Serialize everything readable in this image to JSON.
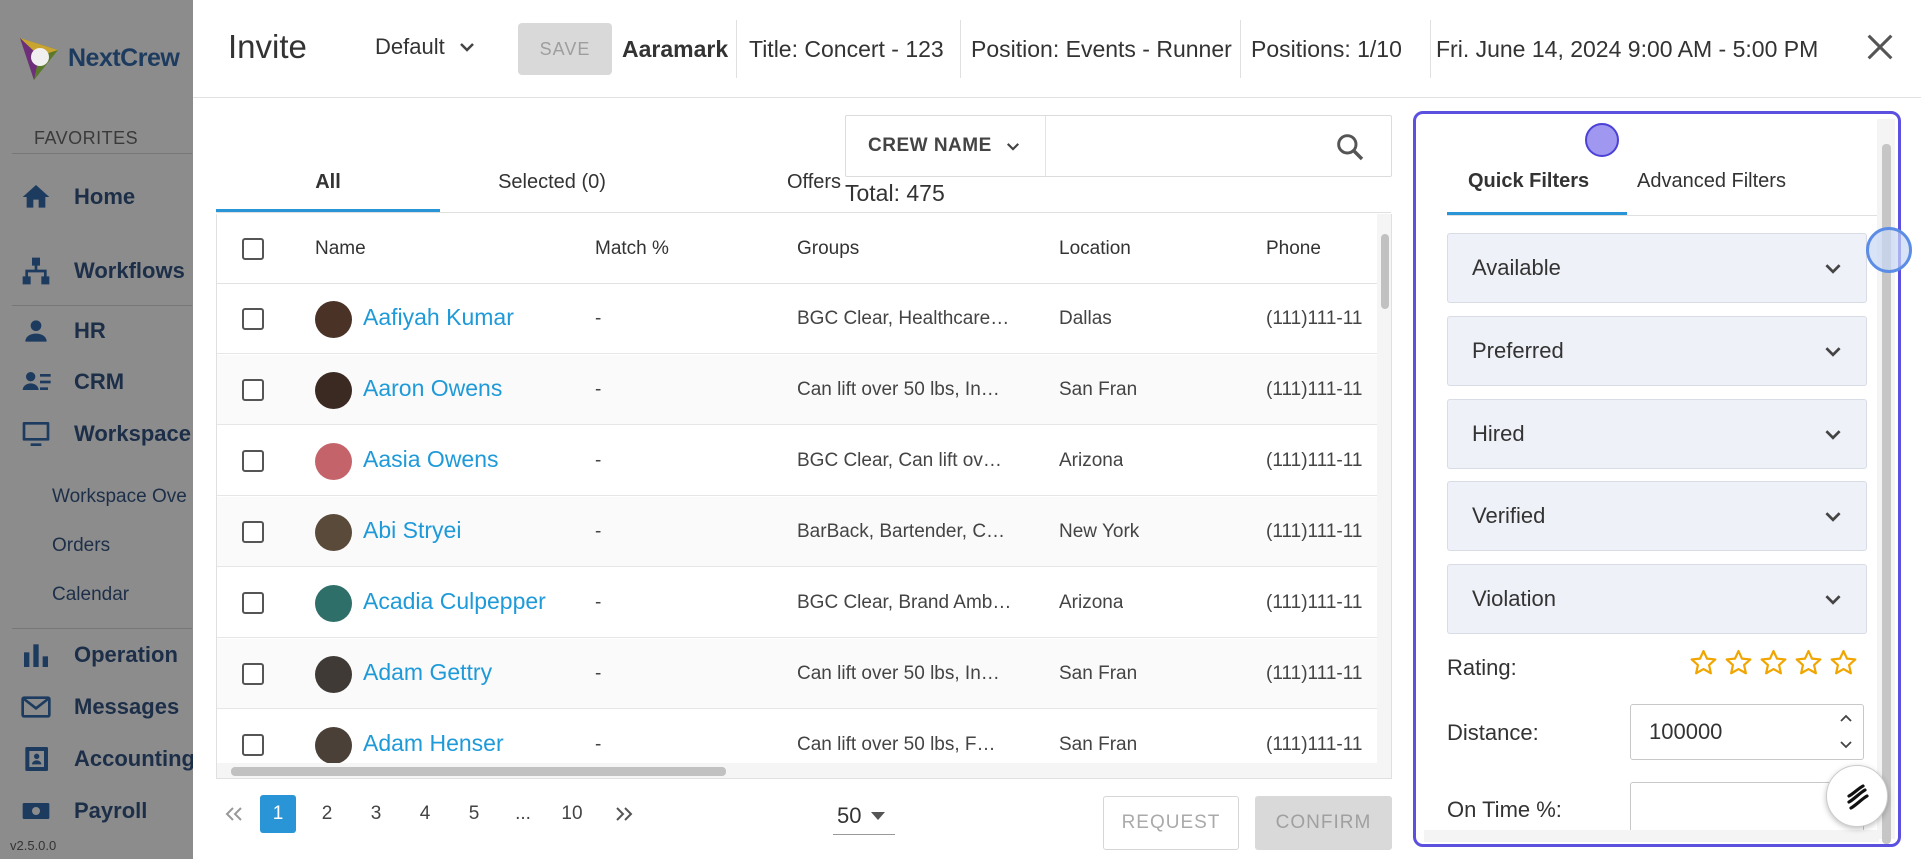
{
  "app": {
    "brand": "NextCrew",
    "favorites_label": "FAVORITES",
    "nav": [
      {
        "label": "Home",
        "icon": "home-icon"
      },
      {
        "label": "Workflows",
        "icon": "workflow-icon"
      },
      {
        "label": "HR",
        "icon": "person-icon"
      },
      {
        "label": "CRM",
        "icon": "contacts-icon"
      },
      {
        "label": "Workspace",
        "icon": "monitor-icon"
      }
    ],
    "workspace_sub": [
      "Workspace Ove",
      "Orders",
      "Calendar"
    ],
    "nav_bottom": [
      {
        "label": "Operation",
        "icon": "bar-chart-icon"
      },
      {
        "label": "Messages",
        "icon": "mail-icon"
      },
      {
        "label": "Accounting",
        "icon": "ledger-icon"
      },
      {
        "label": "Payroll",
        "icon": "money-icon"
      }
    ],
    "version": "v2.5.0.0"
  },
  "header": {
    "title": "Invite",
    "template": "Default",
    "save_label": "SAVE",
    "client": "Aaramark",
    "event_title": "Title: Concert - 123",
    "position": "Position: Events - Runner",
    "positions_count": "Positions: 1/10",
    "datetime": "Fri. June 14, 2024 9:00 AM - 5:00 PM"
  },
  "tabs": [
    "All",
    "Selected (0)",
    "Offers"
  ],
  "search": {
    "field": "CREW NAME",
    "placeholder": ""
  },
  "total": "Total: 475",
  "table": {
    "columns": [
      "Name",
      "Match %",
      "Groups",
      "Location",
      "Phone"
    ],
    "rows": [
      {
        "name": "Aafiyah Kumar",
        "match": "-",
        "groups": "BGC Clear, Healthcare…",
        "location": "Dallas",
        "phone": "(111)111-11"
      },
      {
        "name": "Aaron Owens",
        "match": "-",
        "groups": "Can lift over 50 lbs, In…",
        "location": "San Fran",
        "phone": "(111)111-11"
      },
      {
        "name": "Aasia Owens",
        "match": "-",
        "groups": "BGC Clear, Can lift ov…",
        "location": "Arizona",
        "phone": "(111)111-11"
      },
      {
        "name": "Abi Stryei",
        "match": "-",
        "groups": "BarBack, Bartender, C…",
        "location": "New York",
        "phone": "(111)111-11"
      },
      {
        "name": "Acadia Culpepper",
        "match": "-",
        "groups": "BGC Clear, Brand Amb…",
        "location": "Arizona",
        "phone": "(111)111-11"
      },
      {
        "name": "Adam Gettry",
        "match": "-",
        "groups": "Can lift over 50 lbs, In…",
        "location": "San Fran",
        "phone": "(111)111-11"
      },
      {
        "name": "Adam Henser",
        "match": "-",
        "groups": "Can lift over 50 lbs, F…",
        "location": "San Fran",
        "phone": "(111)111-11"
      }
    ]
  },
  "pagination": {
    "pages": [
      "1",
      "2",
      "3",
      "4",
      "5",
      "...",
      "10"
    ],
    "current": "1",
    "page_size": "50"
  },
  "actions": {
    "request": "REQUEST",
    "confirm": "CONFIRM"
  },
  "filters": {
    "tabs": [
      "Quick Filters",
      "Advanced Filters"
    ],
    "sections": [
      "Available",
      "Preferred",
      "Hired",
      "Verified",
      "Violation"
    ],
    "rating_label": "Rating:",
    "rating_value": 0,
    "rating_max": 5,
    "distance_label": "Distance:",
    "distance_value": "100000",
    "ontime_label": "On Time %:",
    "ontime_value": ""
  },
  "colors": {
    "accent": "#2a95d6",
    "link": "#1e9ad9",
    "focus": "#5b50e0",
    "star": "#f0a500"
  }
}
